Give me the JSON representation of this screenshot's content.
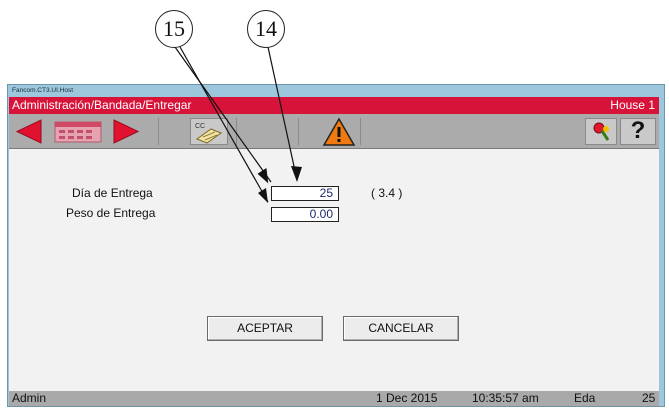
{
  "window": {
    "title": "Fancom.CT3.UI.Host"
  },
  "header": {
    "breadcrumb": "Administración/Bandada/Entregar",
    "house": "House 1"
  },
  "toolbar": {
    "cc_label": "CC",
    "help_label": "?"
  },
  "form": {
    "dia_label": "Día de Entrega",
    "dia_value": "25",
    "dia_hint": "( 3.4 )",
    "peso_label": "Peso de Entrega",
    "peso_value": "0.00"
  },
  "buttons": {
    "accept": "ACEPTAR",
    "cancel": "CANCELAR"
  },
  "status": {
    "user": "Admin",
    "date": "1 Dec 2015",
    "time": "10:35:57 am",
    "section": "Eda",
    "number": "25"
  },
  "callouts": {
    "a": "15",
    "b": "14"
  },
  "colors": {
    "title_bar": "#d8133a",
    "arrows": "#e0122f",
    "field_text": "#1d2a6a"
  },
  "icons": [
    "left-arrow-icon",
    "calendar-icon",
    "right-arrow-icon",
    "document-cc-icon",
    "warning-icon",
    "pin-tool-icon",
    "help-icon"
  ]
}
